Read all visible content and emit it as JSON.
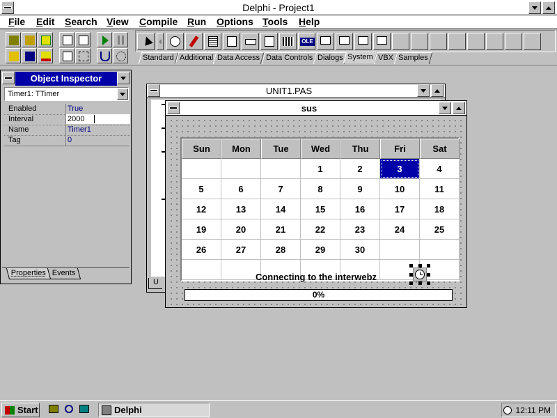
{
  "main_window": {
    "title": "Delphi - Project1"
  },
  "menu": [
    {
      "label": "File",
      "u": "F",
      "rest": "ile"
    },
    {
      "label": "Edit",
      "u": "E",
      "rest": "dit"
    },
    {
      "label": "Search",
      "u": "S",
      "rest": "earch"
    },
    {
      "label": "View",
      "u": "V",
      "rest": "iew"
    },
    {
      "label": "Compile",
      "u": "C",
      "rest": "ompile"
    },
    {
      "label": "Run",
      "u": "R",
      "rest": "un"
    },
    {
      "label": "Options",
      "u": "O",
      "rest": "ptions"
    },
    {
      "label": "Tools",
      "u": "T",
      "rest": "ools"
    },
    {
      "label": "Help",
      "u": "H",
      "rest": "elp"
    }
  ],
  "palette_tabs": [
    "Standard",
    "Additional",
    "Data Access",
    "Data Controls",
    "Dialogs",
    "System",
    "VBX",
    "Samples"
  ],
  "palette_active_tab": "System",
  "palette_icons": {
    "ole_label": "OLE"
  },
  "object_inspector": {
    "title": "Object Inspector",
    "selected_object": "Timer1: TTimer",
    "properties": [
      {
        "name": "Enabled",
        "value": "True"
      },
      {
        "name": "Interval",
        "value": "2000"
      },
      {
        "name": "Name",
        "value": "Timer1"
      },
      {
        "name": "Tag",
        "value": "0"
      }
    ],
    "tabs": [
      "Properties",
      "Events"
    ]
  },
  "unit_window": {
    "title": "UNIT1.PAS",
    "tab": "U"
  },
  "form_window": {
    "title": "sus",
    "calendar": {
      "day_headers": [
        "Sun",
        "Mon",
        "Tue",
        "Wed",
        "Thu",
        "Fri",
        "Sat"
      ],
      "weeks": [
        [
          "",
          "",
          "",
          "1",
          "2",
          "3",
          "4"
        ],
        [
          "5",
          "6",
          "7",
          "8",
          "9",
          "10",
          "11"
        ],
        [
          "12",
          "13",
          "14",
          "15",
          "16",
          "17",
          "18"
        ],
        [
          "19",
          "20",
          "21",
          "22",
          "23",
          "24",
          "25"
        ],
        [
          "26",
          "27",
          "28",
          "29",
          "30",
          "",
          ""
        ],
        [
          "",
          "",
          "",
          "",
          "",
          "",
          ""
        ]
      ],
      "selected_day": "3"
    },
    "status_label": "Connecting to the interwebz",
    "progress_text": "0%",
    "progress_value": 0
  },
  "taskbar": {
    "start_label": "Start",
    "task_label": "Delphi",
    "clock": "12:11 PM"
  },
  "colors": {
    "title_active": "#0000a8",
    "selected_day": "#0000a8",
    "face": "#c0c0c0"
  }
}
